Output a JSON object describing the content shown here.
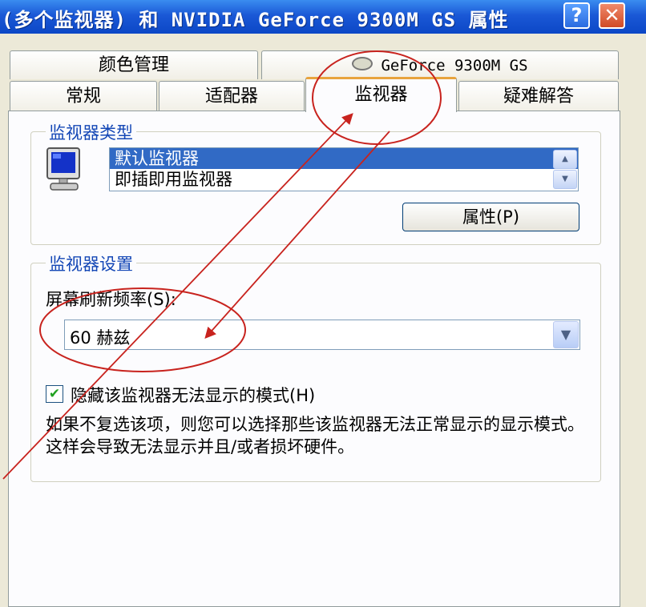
{
  "window": {
    "title": "(多个监视器) 和 NVIDIA GeForce 9300M GS 属性",
    "help_label": "?",
    "close_label": "✕"
  },
  "tabs": {
    "row1": [
      "颜色管理",
      "GeForce 9300M GS"
    ],
    "row2": [
      "常规",
      "适配器",
      "监视器",
      "疑难解答"
    ],
    "active": "监视器"
  },
  "monitor_type": {
    "title": "监视器类型",
    "items": [
      "默认监视器",
      "即插即用监视器"
    ],
    "selected": "默认监视器",
    "properties_button": "属性(P)"
  },
  "monitor_settings": {
    "title": "监视器设置",
    "refresh_label": "屏幕刷新频率(S):",
    "refresh_value": "60 赫兹",
    "hide_modes_label": "隐藏该监视器无法显示的模式(H)",
    "hide_modes_checked": true,
    "description": "如果不复选该项，则您可以选择那些该监视器无法正常显示的显示模式。这样会导致无法显示并且/或者损坏硬件。"
  },
  "colors": {
    "titlebar": "#0c47c6",
    "selection": "#316ac5",
    "group_title": "#1447b6",
    "annotation": "#c8231e",
    "active_tab_accent": "#e8a33c"
  }
}
